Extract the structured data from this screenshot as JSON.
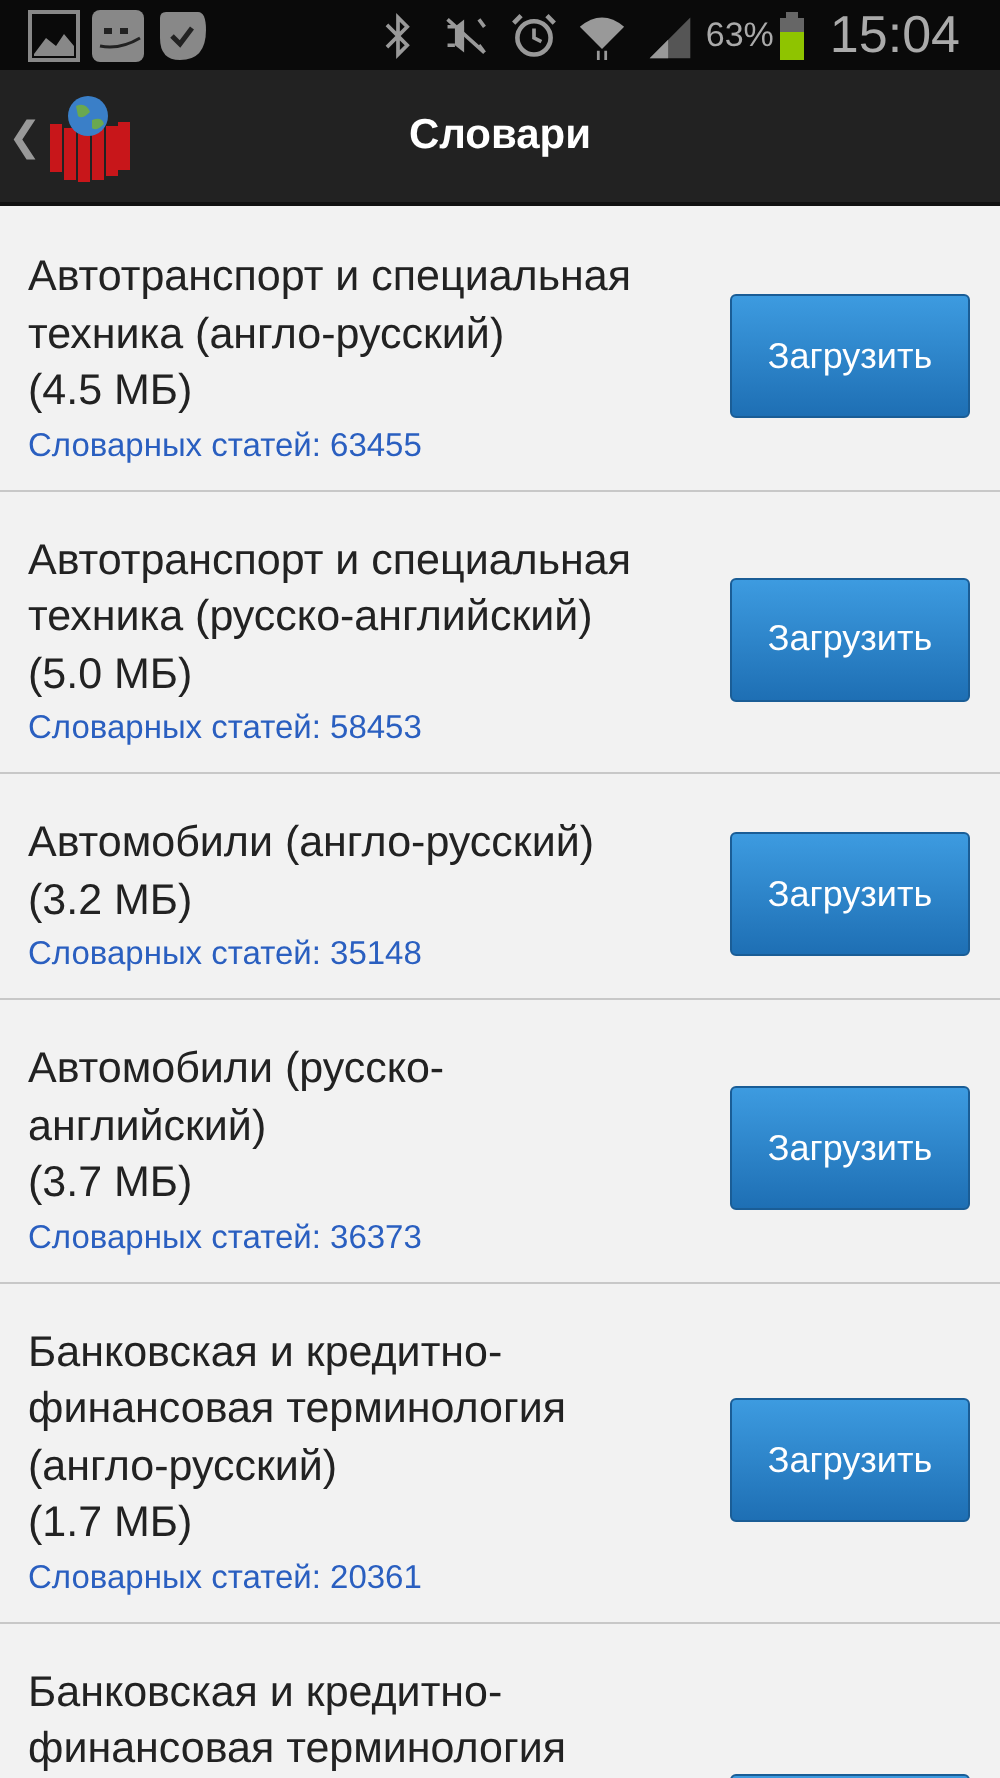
{
  "status_bar": {
    "battery": "63%",
    "time": "15:04"
  },
  "action_bar": {
    "back": "❮",
    "title": "Словари"
  },
  "dictionaries": [
    {
      "title_lines": [
        "Автотранспорт и специальная",
        "техника (англо-русский)",
        "(4.5 МБ)"
      ],
      "entries": "Словарных статей: 63455",
      "button": "Загрузить"
    },
    {
      "title_lines": [
        "Автотранспорт и специальная",
        "техника (русско-английский)",
        "(5.0 МБ)"
      ],
      "entries": "Словарных статей: 58453",
      "button": "Загрузить"
    },
    {
      "title_lines": [
        "Автомобили (англо-русский)",
        "(3.2 МБ)"
      ],
      "entries": "Словарных статей: 35148",
      "button": "Загрузить"
    },
    {
      "title_lines": [
        "Автомобили (русско-",
        "английский)",
        "(3.7 МБ)"
      ],
      "entries": "Словарных статей: 36373",
      "button": "Загрузить"
    },
    {
      "title_lines": [
        "Банковская и кредитно-",
        "финансовая терминология",
        "(англо-русский)",
        "(1.7 МБ)"
      ],
      "entries": "Словарных статей: 20361",
      "button": "Загрузить"
    },
    {
      "title_lines": [
        "Банковская и кредитно-",
        "финансовая терминология"
      ]
    }
  ]
}
